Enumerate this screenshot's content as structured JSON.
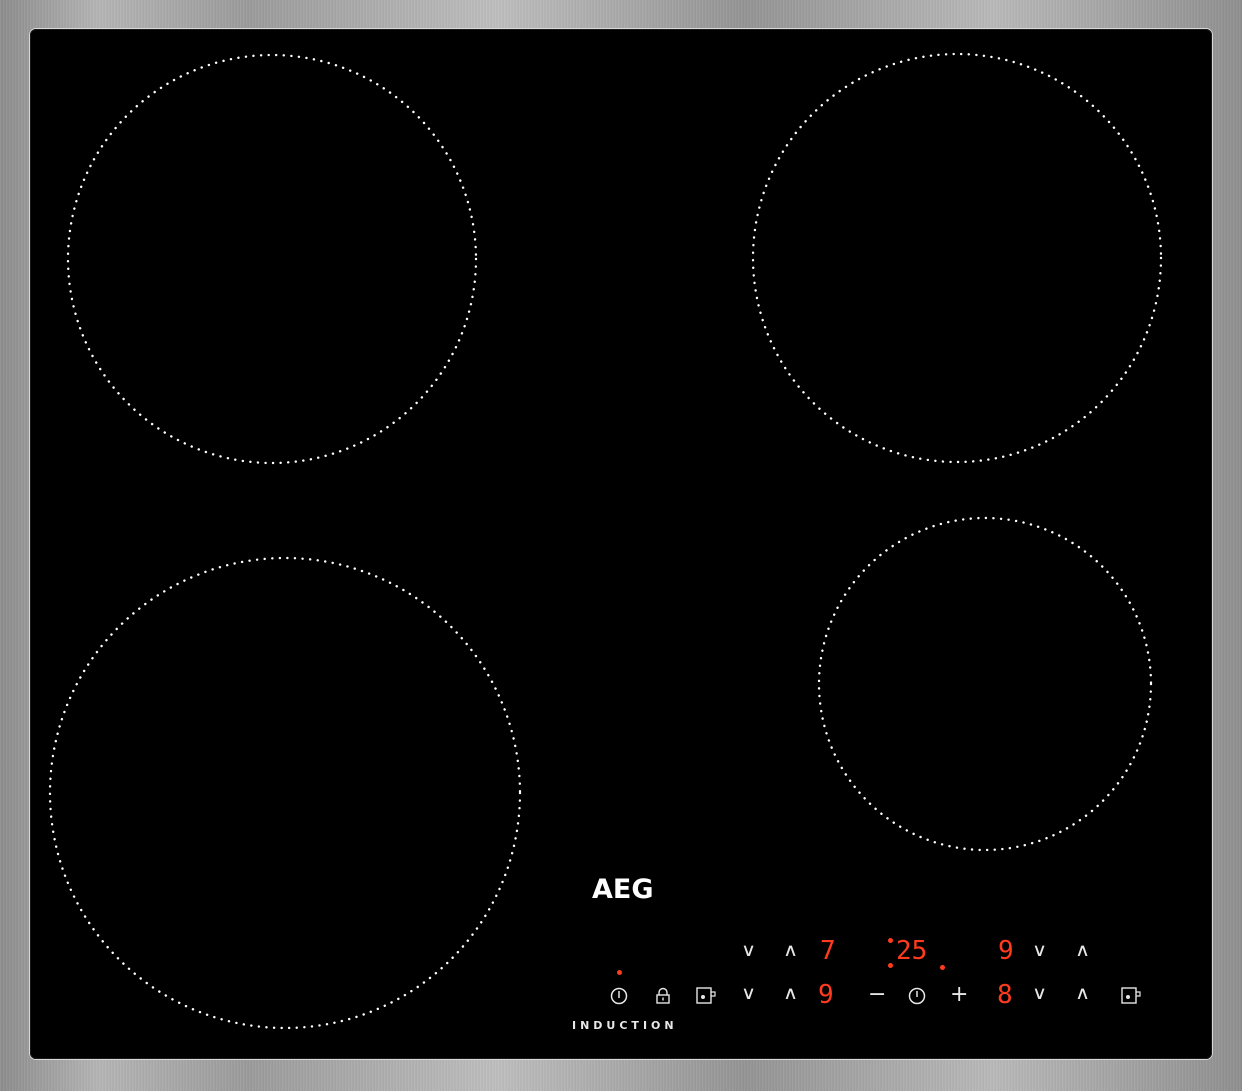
{
  "brand": "AEG",
  "label": "INDUCTION",
  "cooking_zones": [
    {
      "name": "front-left"
    },
    {
      "name": "rear-left"
    },
    {
      "name": "rear-right"
    },
    {
      "name": "front-right"
    }
  ],
  "display": {
    "upper_left_level": "7",
    "timer": "25",
    "upper_right_level": "9",
    "lower_left_level": "9",
    "lower_right_level": "8"
  },
  "controls": {
    "down": "∨",
    "up": "∧",
    "minus": "−",
    "plus": "+"
  },
  "colors": {
    "glass": "#000000",
    "frame": "#a8a8a8",
    "display_red": "#ff3b1f",
    "zone_dots": "#ffffff"
  }
}
